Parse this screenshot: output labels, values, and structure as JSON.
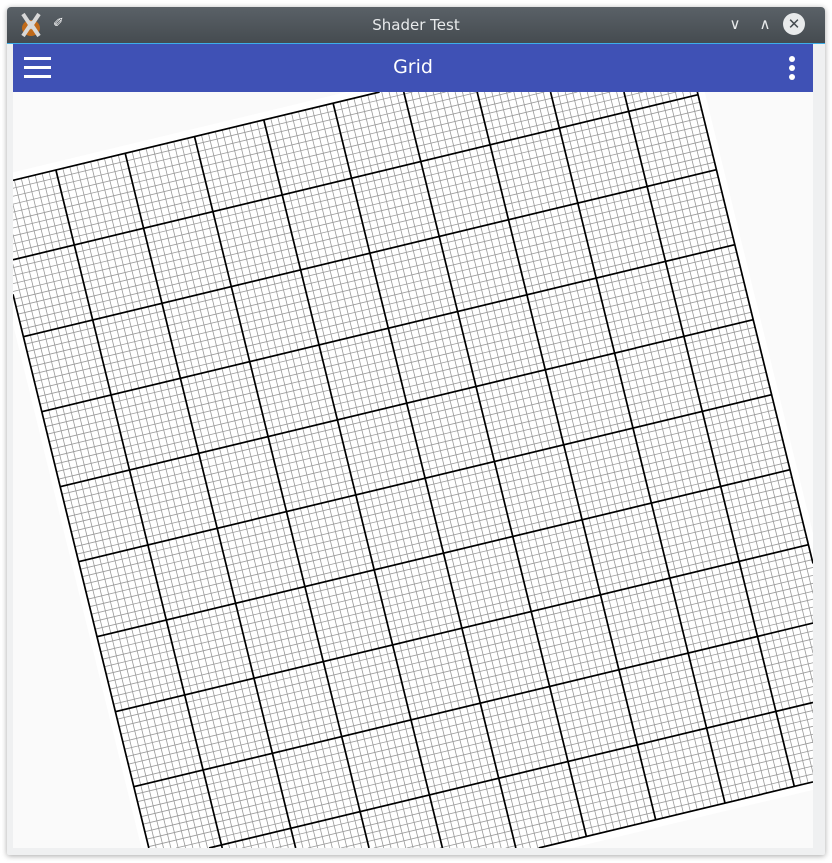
{
  "window": {
    "title": "Shader Test",
    "icons": {
      "app": "kde-app-icon",
      "pin": "pin-icon",
      "minimize": "chevron-down-icon",
      "maximize": "chevron-up-icon",
      "close": "close-icon"
    },
    "glyphs": {
      "pin": "📌",
      "minimize": "∨",
      "maximize": "∧",
      "close": "✕"
    }
  },
  "appbar": {
    "title": "Grid",
    "color": "#3f51b5",
    "menu_icon": "hamburger-menu-icon",
    "overflow_icon": "more-vertical-icon"
  },
  "grid": {
    "major_cells": 10,
    "minor_divisions": 10,
    "rotation_deg": -13,
    "major_color": "#000000",
    "minor_color": "#9a9a9a"
  }
}
